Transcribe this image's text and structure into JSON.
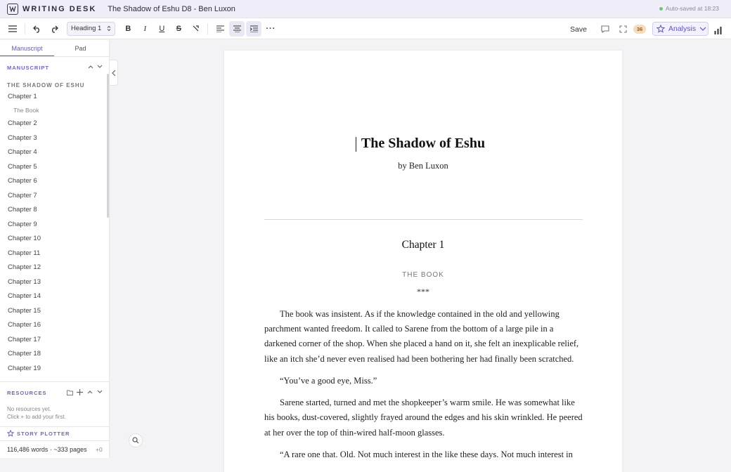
{
  "app": {
    "name": "WRITING DESK",
    "doc_title": "The Shadow of Eshu D8 - Ben Luxon",
    "autosave": "Auto-saved at 18:23"
  },
  "toolbar": {
    "style_select": "Heading 1",
    "save_label": "Save",
    "badge_count": "36",
    "analysis_label": "Analysis"
  },
  "sidebar": {
    "tabs": [
      "Manuscript",
      "Pad"
    ],
    "manuscript_heading": "MANUSCRIPT",
    "book_title": "THE SHADOW OF ESHU",
    "chapter1": "Chapter 1",
    "chapter1_sub": "The Book",
    "chapters": [
      "Chapter 2",
      "Chapter 3",
      "Chapter 4",
      "Chapter 5",
      "Chapter 6",
      "Chapter 7",
      "Chapter 8",
      "Chapter 9",
      "Chapter 10",
      "Chapter 11",
      "Chapter 12",
      "Chapter 13",
      "Chapter 14",
      "Chapter 15",
      "Chapter 16",
      "Chapter 17",
      "Chapter 18",
      "Chapter 19"
    ],
    "resources_heading": "RESOURCES",
    "resources_empty": "No resources yet.",
    "resources_hint": "Click + to add your first.",
    "story_plotter": "STORY PLOTTER",
    "word_count": "116,486 words · ~333 pages",
    "word_delta": "+0"
  },
  "document": {
    "title": "The Shadow of Eshu",
    "byline": "by Ben Luxon",
    "chapter_heading": "Chapter 1",
    "chapter_subtitle": "THE BOOK",
    "scene_break": "***",
    "p1_l1": "The book was insistent. As if the knowledge contained in the old and yellowing",
    "p1_l2": "parchment wanted freedom. It called to Sarene from the bottom of a large pile in a",
    "p1_l3": "darkened corner of the shop. When she placed a hand on it, she felt an inexplicable relief,",
    "p1_l4": "like an itch she’d never even realised had been bothering her had finally been scratched.",
    "p2_l1": "“You’ve a good eye, Miss.”",
    "p3_l1": "Sarene started, turned and met the shopkeeper’s warm smile. He was somewhat like",
    "p3_l2": "his books, dust-covered, slightly frayed around the edges and his skin wrinkled. He peered",
    "p3_l3": "at her over the top of thin-wired half-moon glasses.",
    "p4_l1": "“A rare one that. Old. Not much interest in the like these days. Not much interest in"
  }
}
